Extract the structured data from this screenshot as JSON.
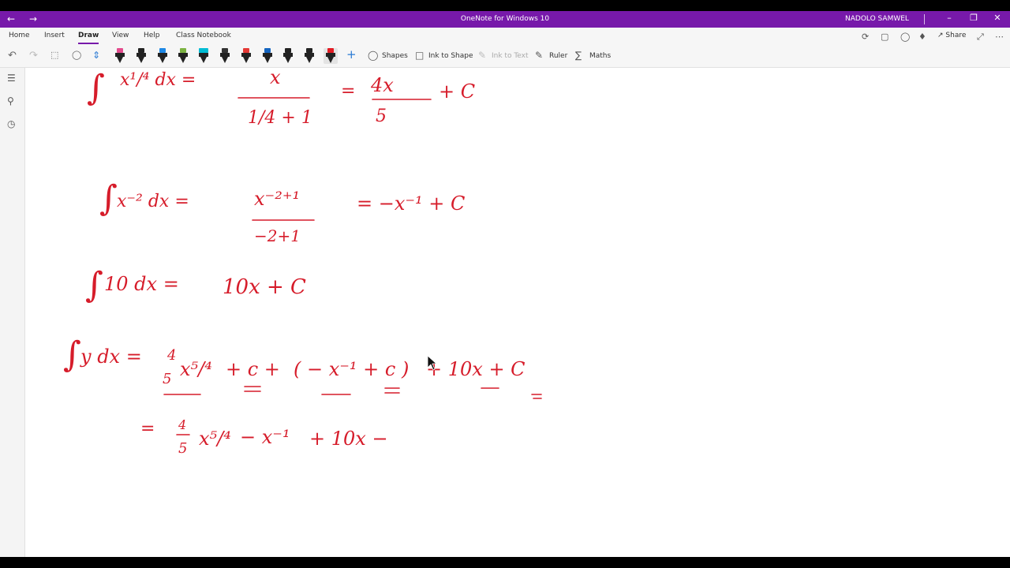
{
  "window": {
    "back_icon": "arrow-left-icon",
    "forward_icon": "arrow-right-icon",
    "title": "OneNote for Windows 10",
    "user": "NADOLO SAMWEL"
  },
  "ribbon": {
    "tabs": [
      {
        "label": "Home"
      },
      {
        "label": "Insert"
      },
      {
        "label": "Draw",
        "active": true
      },
      {
        "label": "View"
      },
      {
        "label": "Help"
      },
      {
        "label": "Class Notebook"
      }
    ],
    "share_label": "Share",
    "tools": {
      "shapes": "Shapes",
      "ink_to_shape": "Ink to Shape",
      "ink_to_text": "Ink to Text",
      "ruler": "Ruler",
      "maths": "Maths"
    },
    "pen_colors": [
      "#e44b8d",
      "#222222",
      "#1e88e5",
      "#7cb342",
      "#00bcd4",
      "#333333",
      "#e53935",
      "#1565c0",
      "#222222",
      "#222222",
      "#e31b23"
    ],
    "accent": "#7719aa",
    "ink_color": "#d61c2a"
  },
  "ink": {
    "line1": {
      "integral": "∫",
      "lhs": "x¹/⁴ dx  =",
      "num": "x",
      "den": "1/4 + 1",
      "eq": "=",
      "coef_num": "4x",
      "coef_den": "5",
      "tail": "+ C"
    },
    "line2": {
      "integral": "∫",
      "lhs": "x⁻² dx  =",
      "num": "x⁻²⁺¹",
      "den": "−2+1",
      "rhs": "= −x⁻¹ + C"
    },
    "line3": {
      "integral": "∫",
      "lhs": "10 dx  =",
      "rhs": "10x + C"
    },
    "line4": {
      "integral": "∫",
      "lhs": "y dx  =",
      "a_num": "4",
      "a_den": "5",
      "a_x": "x⁵/⁴",
      "a_tail": "+ c +",
      "b": "( − x⁻¹ + c )",
      "c": "+   10x + C"
    },
    "line5": {
      "eq": "=",
      "f_num": "4",
      "f_den": "5",
      "term1": "x⁵/⁴",
      "term2": "− x⁻¹",
      "term3": "+ 10x −"
    }
  }
}
